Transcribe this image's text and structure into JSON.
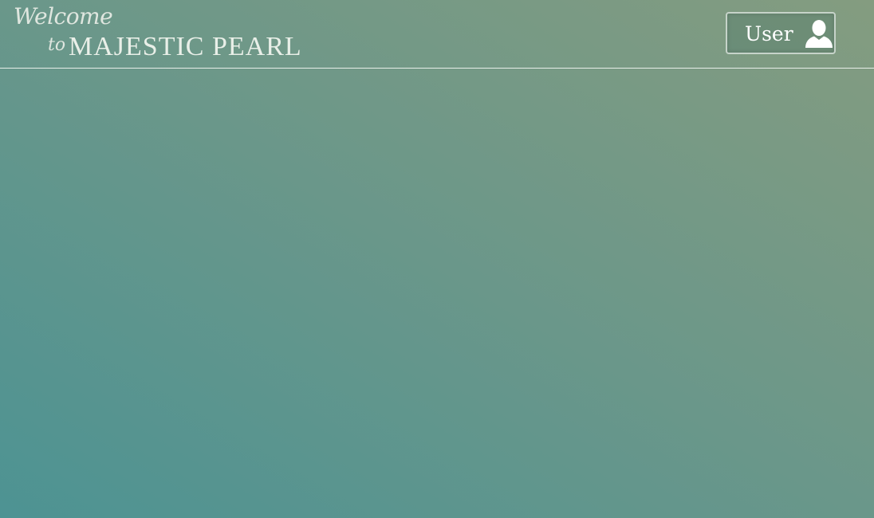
{
  "header": {
    "welcome_text": "Welcome",
    "to_text": "to",
    "brand_name": "MAJESTIC PEARL"
  },
  "user_menu": {
    "label": "User",
    "icon": "user-icon"
  },
  "colors": {
    "background_start": "#4d9393",
    "background_end": "#849c80",
    "text": "#e9efe8",
    "divider": "#e8efe9"
  }
}
